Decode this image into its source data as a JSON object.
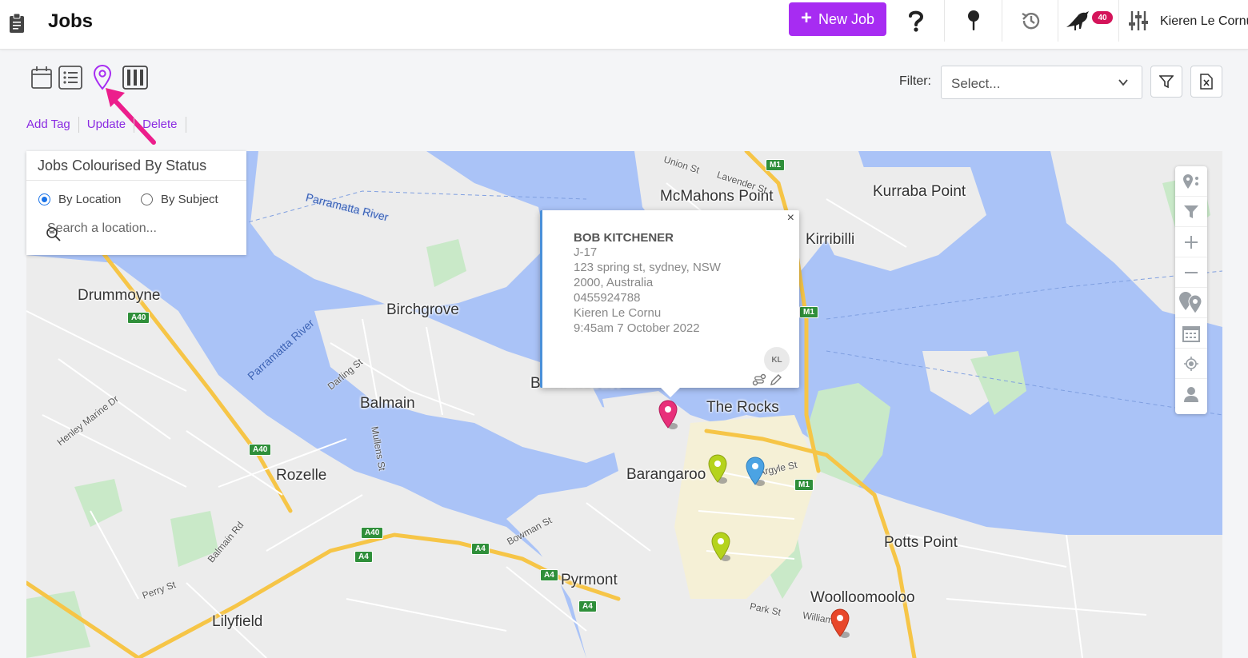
{
  "header": {
    "title": "Jobs",
    "new_job_label": "New Job",
    "notifications_count": "40",
    "user_name": "Kieren Le Cornu"
  },
  "view_switch": {
    "icons": [
      "calendar-view-icon",
      "list-view-icon",
      "map-view-icon",
      "board-view-icon"
    ],
    "active": "map-view-icon",
    "active_color": "#a72cf2"
  },
  "filter": {
    "label": "Filter:",
    "placeholder": "Select..."
  },
  "actions": [
    "Add Tag",
    "Update",
    "Delete"
  ],
  "map": {
    "panel": {
      "title": "Jobs Colourised By Status",
      "radio_options": [
        "By Location",
        "By Subject"
      ],
      "selected": "By Location",
      "search_placeholder": "Search a location..."
    },
    "places": [
      "McMahons Point",
      "Kurraba Point",
      "Kirribilli",
      "Drummoyne",
      "Birchgrove",
      "Balmain",
      "Balmain East",
      "The Rocks",
      "Barangaroo",
      "Rozelle",
      "Potts Point",
      "Pyrmont",
      "Woolloomooloo",
      "Lilyfield"
    ],
    "streets": [
      "Union St",
      "Lavender St",
      "Darling St",
      "Mullens St",
      "Henley Marine Dr",
      "Balmain Rd",
      "Bowman St",
      "Perry St",
      "Park St",
      "William St",
      "Argyle St"
    ],
    "water_labels": [
      "Parramatta River",
      "Parramatta River"
    ],
    "road_shields": [
      "M1",
      "M1",
      "M1",
      "A40",
      "A40",
      "A40",
      "A4",
      "A4",
      "A4",
      "A4"
    ],
    "popup": {
      "name": "BOB KITCHENER",
      "job_id": "J-17",
      "address_line1": "123 spring st, sydney, NSW",
      "address_line2": "2000, Australia",
      "phone": "0455924788",
      "assignee": "Kieren Le Cornu",
      "datetime": "9:45am 7 October 2022",
      "avatar_initials": "KL",
      "close_glyph": "×"
    },
    "pins": [
      {
        "status_color": "#e8307a"
      },
      {
        "status_color": "#b5d31c"
      },
      {
        "status_color": "#4ba3e3"
      },
      {
        "status_color": "#b5d31c"
      },
      {
        "status_color": "#e8472a"
      }
    ],
    "controls": [
      "pin-settings-icon",
      "filter-icon",
      "zoom-in-icon",
      "zoom-out-icon",
      "cluster-pins-icon",
      "calendar-icon",
      "my-location-icon",
      "person-icon"
    ]
  }
}
